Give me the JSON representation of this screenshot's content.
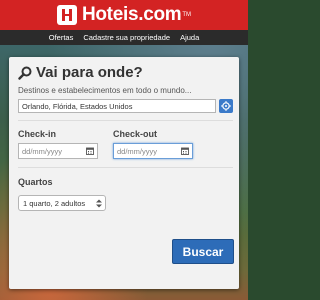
{
  "brand": {
    "name": "Hoteis.com",
    "trademark": "TM",
    "color": "#d32323"
  },
  "nav": {
    "items": [
      {
        "label": "Ofertas"
      },
      {
        "label": "Cadastre sua propriedade"
      },
      {
        "label": "Ajuda"
      }
    ]
  },
  "search": {
    "title": "Vai para onde?",
    "subtitle": "Destinos e estabelecimentos em todo o mundo...",
    "destination_value": "Orlando, Flórida, Estados Unidos",
    "location_icon": "crosshair-icon",
    "checkin_label": "Check-in",
    "checkin_placeholder": "dd/mm/yyyy",
    "checkout_label": "Check-out",
    "checkout_placeholder": "dd/mm/yyyy",
    "rooms_label": "Quartos",
    "rooms_value": "1 quarto, 2 adultos",
    "submit_label": "Buscar",
    "accent_color": "#2d6cb8"
  }
}
